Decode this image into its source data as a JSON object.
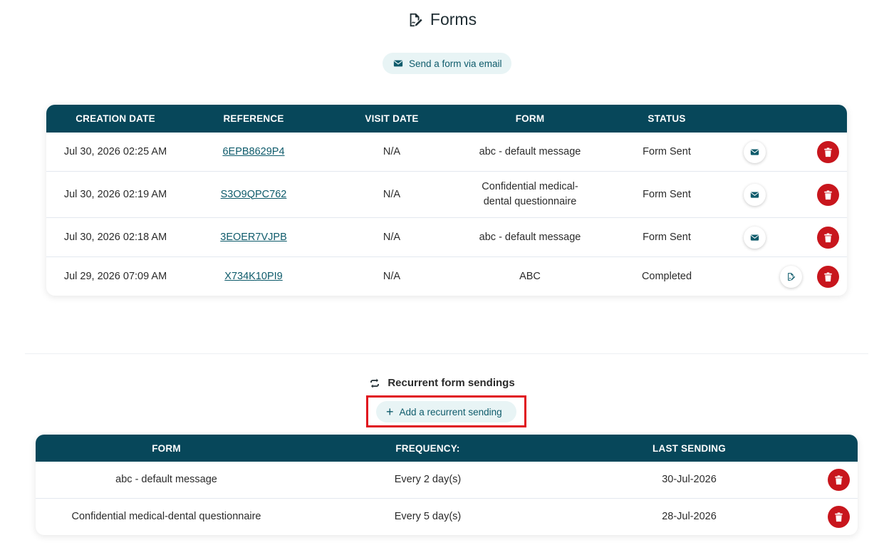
{
  "page": {
    "title": "Forms",
    "title_icon": "signature-form-icon",
    "send_email_button": "Send a form via email"
  },
  "forms_table": {
    "headers": [
      "CREATION DATE",
      "REFERENCE",
      "VISIT DATE",
      "FORM",
      "STATUS"
    ],
    "rows": [
      {
        "creation_date": "Jul 30, 2026 02:25 AM",
        "reference": "6EPB8629P4",
        "visit_date": "N/A",
        "form": "abc - default message",
        "status": "Form Sent",
        "action_icon": "envelope-icon"
      },
      {
        "creation_date": "Jul 30, 2026 02:19 AM",
        "reference": "S3O9QPC762",
        "visit_date": "N/A",
        "form": "Confidential medical-dental questionnaire",
        "status": "Form Sent",
        "action_icon": "envelope-icon"
      },
      {
        "creation_date": "Jul 30, 2026 02:18 AM",
        "reference": "3EOER7VJPB",
        "visit_date": "N/A",
        "form": "abc - default message",
        "status": "Form Sent",
        "action_icon": "envelope-icon"
      },
      {
        "creation_date": "Jul 29, 2026 07:09 AM",
        "reference": "X734K10PI9",
        "visit_date": "N/A",
        "form": "ABC",
        "status": "Completed",
        "action_icon": "signature-form-icon"
      }
    ]
  },
  "recurrent": {
    "title": "Recurrent form sendings",
    "title_icon": "repeat-icon",
    "add_button": "Add a recurrent sending",
    "headers": [
      "FORM",
      "FREQUENCY:",
      "LAST SENDING"
    ],
    "rows": [
      {
        "form": "abc - default message",
        "frequency": "Every 2 day(s)",
        "last_sending": "30-Jul-2026"
      },
      {
        "form": "Confidential medical-dental questionnaire",
        "frequency": "Every 5 day(s)",
        "last_sending": "28-Jul-2026"
      }
    ]
  },
  "colors": {
    "header_bg": "#07475a",
    "accent": "#0e5b6b",
    "pill_bg": "#e8f4f5",
    "delete": "#c8161d",
    "highlight": "#e0141e"
  }
}
